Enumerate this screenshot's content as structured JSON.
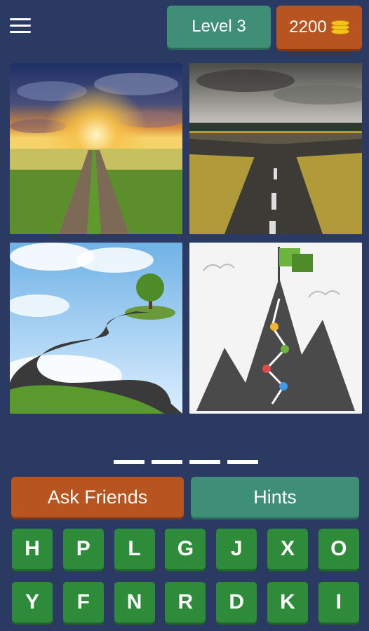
{
  "header": {
    "level_label": "Level 3",
    "coins": "2200"
  },
  "puzzle": {
    "images": [
      {
        "name": "sunset-road"
      },
      {
        "name": "crossroads"
      },
      {
        "name": "floating-island-road"
      },
      {
        "name": "mountain-path-flag"
      }
    ],
    "answer_length": 4
  },
  "actions": {
    "ask_friends": "Ask Friends",
    "hints": "Hints"
  },
  "keyboard": {
    "row1": [
      "H",
      "P",
      "L",
      "G",
      "J",
      "X",
      "O"
    ],
    "row2": [
      "Y",
      "F",
      "N",
      "R",
      "D",
      "K",
      "I"
    ]
  },
  "colors": {
    "background": "#2b3a63",
    "teal": "#3f8f76",
    "orange": "#b8541f",
    "key_green": "#2e8b3a"
  }
}
